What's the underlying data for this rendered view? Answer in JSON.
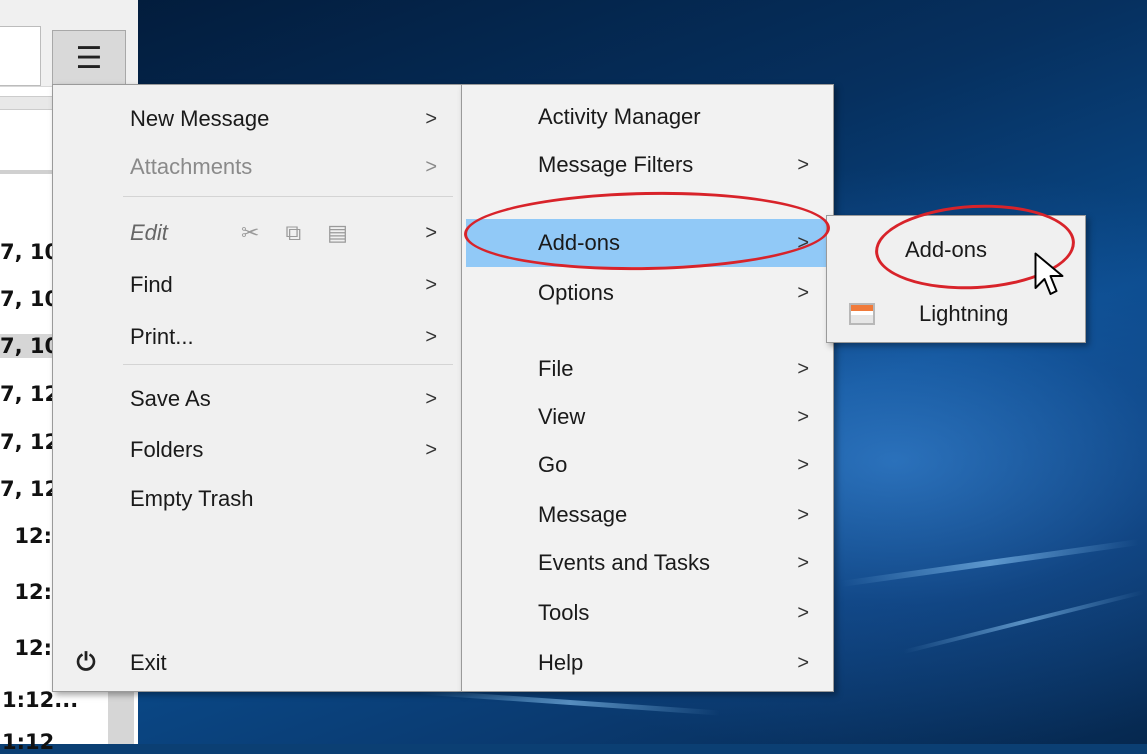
{
  "app": {
    "menu_button_glyph": "☰",
    "list_fragments": [
      {
        "text": "7, 10",
        "selected": false
      },
      {
        "text": "7, 10",
        "selected": false
      },
      {
        "text": "7, 10",
        "selected": true
      },
      {
        "text": "7, 12",
        "selected": false
      },
      {
        "text": "7, 12",
        "selected": false
      },
      {
        "text": "7, 12",
        "selected": false
      },
      {
        "text": "12:",
        "selected": false
      },
      {
        "text": "12:",
        "selected": false
      },
      {
        "text": "12:",
        "selected": false
      },
      {
        "text": "1:12...",
        "selected": false
      },
      {
        "text": "1:12",
        "selected": false
      }
    ]
  },
  "main_menu": {
    "new_message": "New Message",
    "attachments": "Attachments",
    "edit": "Edit",
    "find": "Find",
    "print": "Print...",
    "save_as": "Save As",
    "folders": "Folders",
    "empty_trash": "Empty Trash",
    "exit": "Exit",
    "arrow": ">"
  },
  "right_menu": {
    "activity_manager": "Activity Manager",
    "message_filters": "Message Filters",
    "add_ons": "Add-ons",
    "options": "Options",
    "file": "File",
    "view": "View",
    "go": "Go",
    "message": "Message",
    "events_and_tasks": "Events and Tasks",
    "tools": "Tools",
    "help": "Help"
  },
  "submenu": {
    "add_ons": "Add-ons",
    "lightning": "Lightning"
  },
  "colors": {
    "highlight": "#91c9f7",
    "annotation": "#d8232a"
  },
  "icons": {
    "exit": "power-icon",
    "cut": "scissors-icon",
    "copy": "copy-icon",
    "paste": "clipboard-icon",
    "lightning": "calendar-icon"
  }
}
